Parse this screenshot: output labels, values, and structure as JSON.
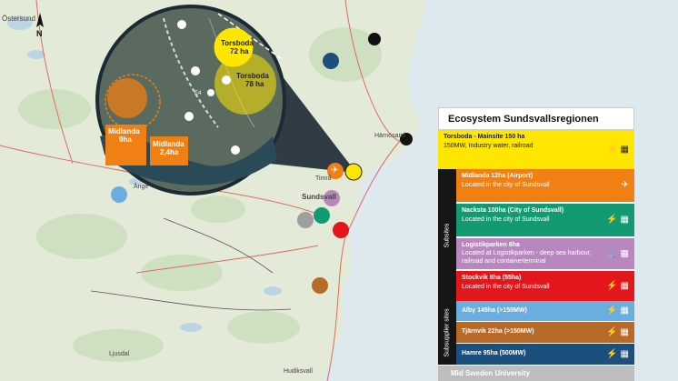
{
  "map": {
    "places": {
      "ostersund": "Östersund",
      "ange": "Ånge",
      "sundsvall": "Sundsvall",
      "timra": "Timrå",
      "harnosand": "Härnösand",
      "hudiksvall": "Hudiksvall",
      "ljusdal": "Ljusdal",
      "north": "N"
    }
  },
  "inset": {
    "torsboda_72": "Torsboda",
    "torsboda_72_area": "72 ha",
    "torsboda_78": "Torsboda",
    "torsboda_78_area": "78 ha",
    "midlanda_9": "Midlanda",
    "midlanda_9_area": "9ha",
    "midlanda_24": "Midlanda",
    "midlanda_24_area": "2,4ha",
    "road_label": "E4"
  },
  "legend": {
    "title": "Ecosystem Sundsvallsregionen",
    "subsites_label": "Subsites",
    "subsupplier_label": "Subsupplier sites",
    "rows": [
      {
        "title": "Torsboda - Mainsite 150 ha",
        "sub": "150MW, Industry water, railroad",
        "color": "#ffe600",
        "icon": "⚡ ▦"
      },
      {
        "title": "Midlanda 12ha (Airport)",
        "sub": "Located in the city of Sundsvall",
        "color": "#f07f14",
        "icon": "✈"
      },
      {
        "title": "Nacksta 100ha (City of Sundsvall)",
        "sub": "Located in the city of Sundsvall",
        "color": "#139a72",
        "icon": "⚡ ▦"
      },
      {
        "title": "Logistikparken 6ha",
        "sub": "Located at Logistikparken - deep sea harbour, railroad and containerterminal",
        "color": "#b987c0",
        "icon": "⚓ ▦"
      },
      {
        "title": "Stockvik 8ha (55ha)",
        "sub": "Located in the city of Sundsvall",
        "color": "#e3161b",
        "icon": "⚡ ▦"
      },
      {
        "title": "Alby 145ha (>150MW)",
        "sub": "",
        "color": "#6aaee0",
        "icon": "⚡ ▦"
      },
      {
        "title": "Tjärnvik 22ha (>150MW)",
        "sub": "",
        "color": "#b86a2b",
        "icon": "⚡ ▦"
      },
      {
        "title": "Hamre 95ha (500MW)",
        "sub": "",
        "color": "#1d4f7d",
        "icon": "⚡ ▦"
      }
    ],
    "bottom": "Mid Sweden University"
  },
  "markers": {
    "colors": {
      "torsboda": "#ffe600",
      "midlanda": "#f07f14",
      "nacksta": "#139a72",
      "logistik": "#b987c0",
      "stockvik": "#e3161b",
      "alby": "#6aaee0",
      "tjarnvik": "#b86a2b",
      "hamre": "#1d4f7d",
      "black": "#111111",
      "grey": "#9e9e9e"
    }
  }
}
